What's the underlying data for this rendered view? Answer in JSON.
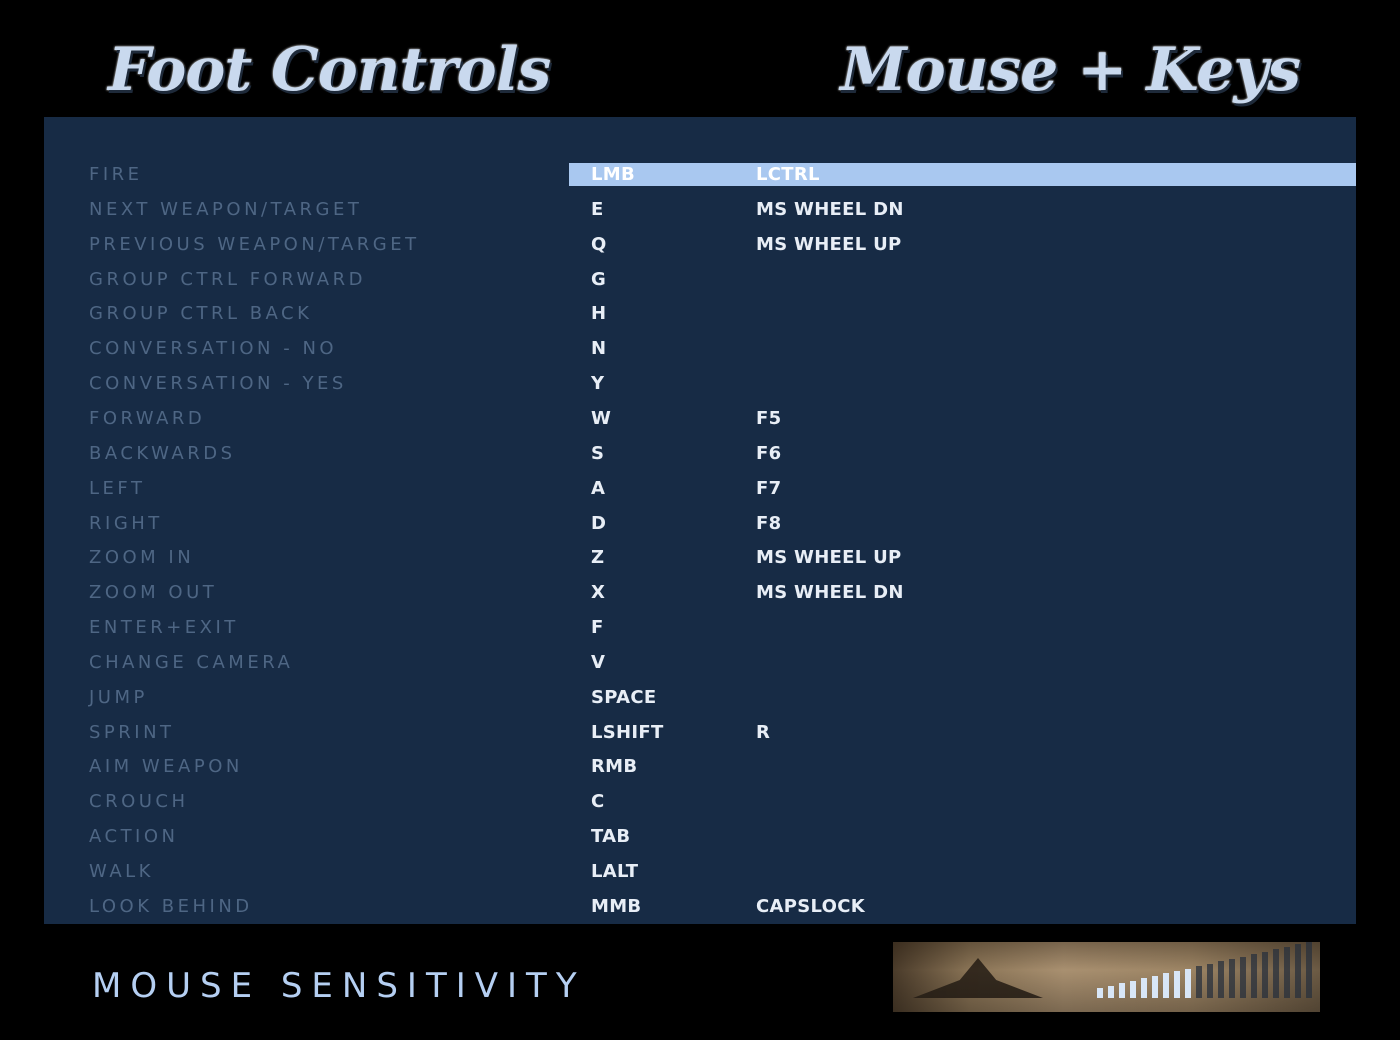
{
  "header": {
    "title_left": "Foot Controls",
    "title_right": "Mouse + Keys"
  },
  "colors": {
    "panel_bg": "#172b45",
    "action_text": "#4e6684",
    "key_text": "#e8eef6",
    "highlight": "#a9c8f0",
    "sensitivity_label": "#b5cff2"
  },
  "controls": [
    {
      "action": "FIRE",
      "key1": "LMB",
      "key2": "LCTRL",
      "selected": true
    },
    {
      "action": "NEXT WEAPON/TARGET",
      "key1": "E",
      "key2": "MS WHEEL DN"
    },
    {
      "action": "PREVIOUS WEAPON/TARGET",
      "key1": "Q",
      "key2": "MS WHEEL UP"
    },
    {
      "action": "GROUP CTRL FORWARD",
      "key1": "G",
      "key2": ""
    },
    {
      "action": "GROUP CTRL BACK",
      "key1": "H",
      "key2": ""
    },
    {
      "action": "CONVERSATION - NO",
      "key1": "N",
      "key2": ""
    },
    {
      "action": "CONVERSATION - YES",
      "key1": "Y",
      "key2": ""
    },
    {
      "action": "FORWARD",
      "key1": "W",
      "key2": "F5"
    },
    {
      "action": "BACKWARDS",
      "key1": "S",
      "key2": "F6"
    },
    {
      "action": "LEFT",
      "key1": "A",
      "key2": "F7"
    },
    {
      "action": "RIGHT",
      "key1": "D",
      "key2": "F8"
    },
    {
      "action": "ZOOM IN",
      "key1": "Z",
      "key2": "MS WHEEL UP"
    },
    {
      "action": "ZOOM OUT",
      "key1": "X",
      "key2": "MS WHEEL DN"
    },
    {
      "action": "ENTER+EXIT",
      "key1": "F",
      "key2": ""
    },
    {
      "action": "CHANGE CAMERA",
      "key1": "V",
      "key2": ""
    },
    {
      "action": "JUMP",
      "key1": "SPACE",
      "key2": ""
    },
    {
      "action": "SPRINT",
      "key1": "LSHIFT",
      "key2": "R"
    },
    {
      "action": "AIM WEAPON",
      "key1": "RMB",
      "key2": ""
    },
    {
      "action": "CROUCH",
      "key1": "C",
      "key2": ""
    },
    {
      "action": "ACTION",
      "key1": "TAB",
      "key2": ""
    },
    {
      "action": "WALK",
      "key1": "LALT",
      "key2": ""
    },
    {
      "action": "LOOK BEHIND",
      "key1": "MMB",
      "key2": "CAPSLOCK"
    }
  ],
  "mouse_sensitivity": {
    "label": "MOUSE SENSITIVITY",
    "total_bars": 20,
    "filled_bars": 9,
    "level_fraction": 0.45
  }
}
